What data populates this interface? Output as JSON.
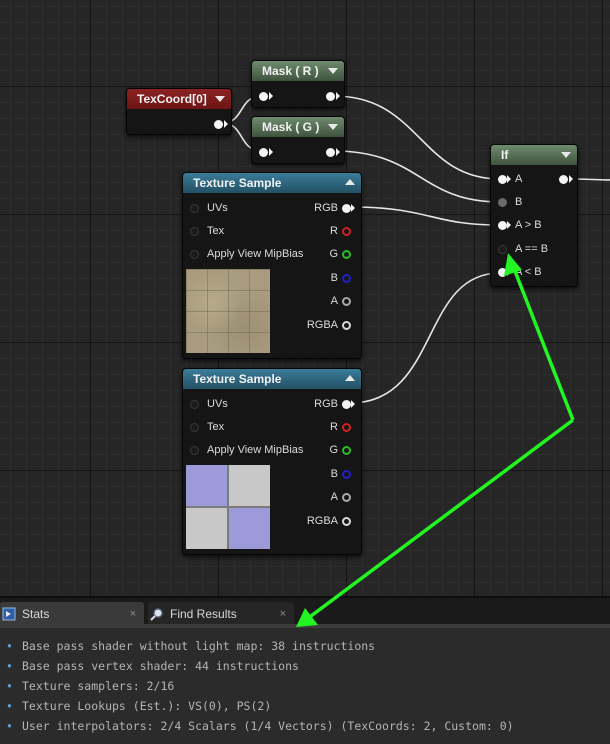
{
  "nodes": {
    "texcoord": {
      "title": "TexCoord[0]"
    },
    "mask_r": {
      "title": "Mask ( R )"
    },
    "mask_g": {
      "title": "Mask ( G )"
    },
    "if_node": {
      "title": "If",
      "inputs": [
        "A",
        "B",
        "A > B",
        "A == B",
        "A < B"
      ]
    },
    "texture_sample_1": {
      "title": "Texture Sample",
      "inputs": [
        "UVs",
        "Tex",
        "Apply View MipBias"
      ],
      "outputs": [
        "RGB",
        "R",
        "G",
        "B",
        "A",
        "RGBA"
      ]
    },
    "texture_sample_2": {
      "title": "Texture Sample",
      "inputs": [
        "UVs",
        "Tex",
        "Apply View MipBias"
      ],
      "outputs": [
        "RGB",
        "R",
        "G",
        "B",
        "A",
        "RGBA"
      ]
    }
  },
  "tabs": [
    {
      "label": "Stats",
      "close": "×",
      "icon": "stats-icon",
      "active": true
    },
    {
      "label": "Find Results",
      "close": "×",
      "icon": "magnifier-icon",
      "active": false
    }
  ],
  "stats": {
    "bullet": "•",
    "lines": [
      "Base pass shader without light map: 38 instructions",
      "Base pass vertex shader: 44 instructions",
      "Texture samplers: 2/16",
      "Texture Lookups (Est.): VS(0), PS(2)",
      "User interpolators: 2/4 Scalars (1/4 Vectors) (TexCoords: 2, Custom: 0)"
    ]
  },
  "colors": {
    "annotation_arrow": "#22f522",
    "texcoord_header": "#8c2323",
    "mask_header": "#5c7a5b",
    "texture_header": "#2f6a86"
  }
}
